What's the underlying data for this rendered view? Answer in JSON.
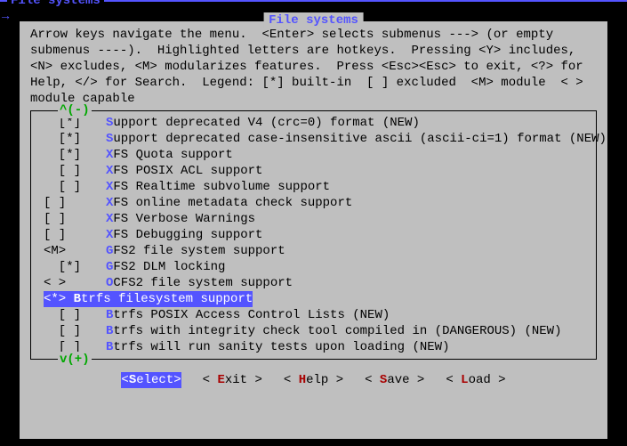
{
  "outer_title": "File systems",
  "inner_title": "File systems",
  "help_text": "Arrow keys navigate the menu.  <Enter> selects submenus ---> (or empty submenus ----).  Highlighted letters are hotkeys.  Pressing <Y> includes, <N> excludes, <M> modularizes features.  Press <Esc><Esc> to exit, <?> for Help, </> for Search.  Legend: [*] built-in  [ ] excluded  <M> module  < > module capable",
  "scroll_top": "^(-)",
  "scroll_bot": "v(+)",
  "items": [
    {
      "tag": "[*]  ",
      "hk": "S",
      "rest": "upport deprecated V4 (crc=0) format (NEW)",
      "indent": "  "
    },
    {
      "tag": "[*]  ",
      "hk": "S",
      "rest": "upport deprecated case-insensitive ascii (ascii-ci=1) format (NEW)",
      "indent": "  "
    },
    {
      "tag": "[*]  ",
      "hk": "X",
      "rest": "FS Quota support",
      "indent": "  "
    },
    {
      "tag": "[ ]  ",
      "hk": "X",
      "rest": "FS POSIX ACL support",
      "indent": "  "
    },
    {
      "tag": "[ ]  ",
      "hk": "X",
      "rest": "FS Realtime subvolume support",
      "indent": "  "
    },
    {
      "tag": "[ ] ",
      "hk": "X",
      "rest": "FS online metadata check support",
      "indent": ""
    },
    {
      "tag": "[ ] ",
      "hk": "X",
      "rest": "FS Verbose Warnings",
      "indent": ""
    },
    {
      "tag": "[ ] ",
      "hk": "X",
      "rest": "FS Debugging support",
      "indent": ""
    },
    {
      "tag": "<M> ",
      "hk": "G",
      "rest": "FS2 file system support",
      "indent": ""
    },
    {
      "tag": "[*]  ",
      "hk": "G",
      "rest": "FS2 DLM locking",
      "indent": "  "
    },
    {
      "tag": "< > ",
      "hk": "O",
      "rest": "CFS2 file system support",
      "indent": ""
    },
    {
      "tag": "<*> ",
      "hk": "B",
      "rest": "trfs filesystem support",
      "indent": "",
      "selected": true
    },
    {
      "tag": "[ ]  ",
      "hk": "B",
      "rest": "trfs POSIX Access Control Lists (NEW)",
      "indent": "  "
    },
    {
      "tag": "[ ]  ",
      "hk": "B",
      "rest": "trfs with integrity check tool compiled in (DANGEROUS) (NEW)",
      "indent": "  "
    },
    {
      "tag": "[ ]  ",
      "hk": "B",
      "rest": "trfs will run sanity tests upon loading (NEW)",
      "indent": "  "
    }
  ],
  "buttons": [
    {
      "pre": "<",
      "hk": "S",
      "rest": "elect>",
      "active": true
    },
    {
      "pre": "< ",
      "hk": "E",
      "rest": "xit >",
      "active": false
    },
    {
      "pre": "< ",
      "hk": "H",
      "rest": "elp >",
      "active": false
    },
    {
      "pre": "< ",
      "hk": "S",
      "rest": "ave >",
      "active": false
    },
    {
      "pre": "< ",
      "hk": "L",
      "rest": "oad >",
      "active": false
    }
  ]
}
